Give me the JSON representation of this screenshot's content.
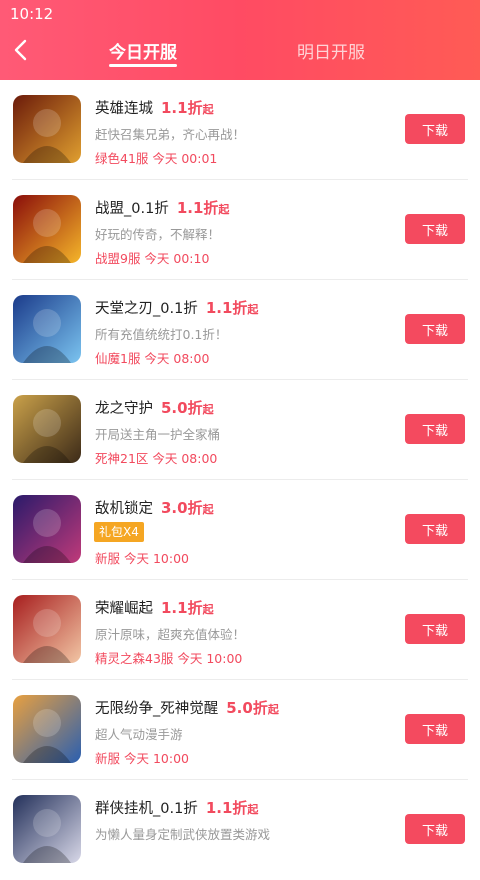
{
  "status": {
    "time": "10:12"
  },
  "header": {
    "tabs": [
      {
        "label": "今日开服",
        "active": true
      },
      {
        "label": "明日开服",
        "active": false
      }
    ]
  },
  "suffix": "起",
  "download_label": "下载",
  "games": [
    {
      "name": "英雄连城",
      "discount": "1.1折",
      "desc": "赶快召集兄弟，齐心再战！",
      "server": "绿色41服 今天 00:01",
      "icon": "red-warrior-game-icon",
      "badge": "",
      "colors": [
        "#6b1a0a",
        "#e0a030"
      ]
    },
    {
      "name": "战盟_0.1折",
      "discount": "1.1折",
      "desc": "好玩的传奇，不解释！",
      "server": "战盟9服 今天 00:10",
      "icon": "battle-alliance-game-icon",
      "badge": "",
      "colors": [
        "#8a0d0a",
        "#f5b62a"
      ]
    },
    {
      "name": "天堂之刃_0.1折",
      "discount": "1.1折",
      "desc": "所有充值统统打0.1折！",
      "server": "仙魔1服 今天 08:00",
      "icon": "wolf-knight-game-icon",
      "badge": "",
      "colors": [
        "#1b3b8a",
        "#7bc4f0"
      ]
    },
    {
      "name": "龙之守护",
      "discount": "5.0折",
      "desc": "开局送主角一护全家桶",
      "server": "死神21区 今天 08:00",
      "icon": "anime-hero-game-icon",
      "badge": "",
      "colors": [
        "#caa14a",
        "#3c2a18"
      ]
    },
    {
      "name": "敌机锁定",
      "discount": "3.0折",
      "desc": "",
      "server": "新服 今天 10:00",
      "icon": "mech-robot-game-icon",
      "badge": "礼包X4",
      "colors": [
        "#2a1a6a",
        "#c03a7a"
      ]
    },
    {
      "name": "荣耀崛起",
      "discount": "1.1折",
      "desc": "原汁原味，超爽充值体验！",
      "server": "精灵之森43服 今天 10:00",
      "icon": "red-hair-girl-game-icon",
      "badge": "",
      "colors": [
        "#a71e1e",
        "#f2c6a5"
      ]
    },
    {
      "name": "无限纷争_死神觉醒",
      "discount": "5.0折",
      "desc": "超人气动漫手游",
      "server": "新服 今天 10:00",
      "icon": "masked-hero-game-icon",
      "badge": "",
      "colors": [
        "#e8a040",
        "#2a5fb0"
      ]
    },
    {
      "name": "群侠挂机_0.1折",
      "discount": "1.1折",
      "desc": "为懒人量身定制武侠放置类游戏",
      "server": "",
      "icon": "wuxia-swordsman-game-icon",
      "badge": "",
      "colors": [
        "#23305a",
        "#d8d8e8"
      ]
    }
  ]
}
